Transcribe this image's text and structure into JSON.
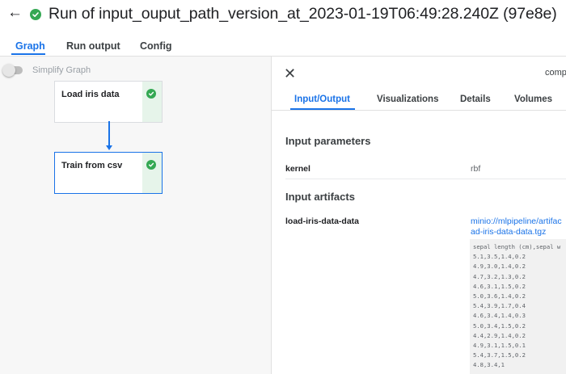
{
  "header": {
    "back_icon": "arrow-left-icon",
    "status_icon": "check-circle-icon",
    "status_color": "#34a853",
    "title": "Run of input_ouput_path_version_at_2023-01-19T06:49:28.240Z (97e8e)"
  },
  "tabs": [
    {
      "label": "Graph",
      "active": true
    },
    {
      "label": "Run output",
      "active": false
    },
    {
      "label": "Config",
      "active": false
    }
  ],
  "graph": {
    "simplify_toggle_label": "Simplify Graph",
    "simplify_toggle_on": false,
    "nodes": [
      {
        "label": "Load iris data",
        "status": "succeeded",
        "selected": false
      },
      {
        "label": "Train from csv",
        "status": "succeeded",
        "selected": true
      }
    ]
  },
  "side_panel": {
    "close_icon": "close-icon",
    "title": "comp",
    "tabs": [
      {
        "label": "Input/Output",
        "active": true
      },
      {
        "label": "Visualizations",
        "active": false
      },
      {
        "label": "Details",
        "active": false
      },
      {
        "label": "Volumes",
        "active": false
      }
    ],
    "input_parameters_heading": "Input parameters",
    "parameters": [
      {
        "name": "kernel",
        "value": "rbf"
      }
    ],
    "input_artifacts_heading": "Input artifacts",
    "artifacts": [
      {
        "name": "load-iris-data-data",
        "link_line1": "minio://mlpipeline/artifac",
        "link_line2": "ad-iris-data-data.tgz",
        "preview_lines": [
          "sepal length (cm),sepal w",
          "5.1,3.5,1.4,0.2",
          "4.9,3.0,1.4,0.2",
          "4.7,3.2,1.3,0.2",
          "4.6,3.1,1.5,0.2",
          "5.0,3.6,1.4,0.2",
          "5.4,3.9,1.7,0.4",
          "4.6,3.4,1.4,0.3",
          "5.0,3.4,1.5,0.2",
          "4.4,2.9,1.4,0.2",
          "4.9,3.1,1.5,0.1",
          "5.4,3.7,1.5,0.2",
          "4.8,3.4,1"
        ]
      }
    ]
  },
  "colors": {
    "accent": "#1a73e8",
    "success": "#34a853",
    "graph_background": "#f7f7f7"
  }
}
